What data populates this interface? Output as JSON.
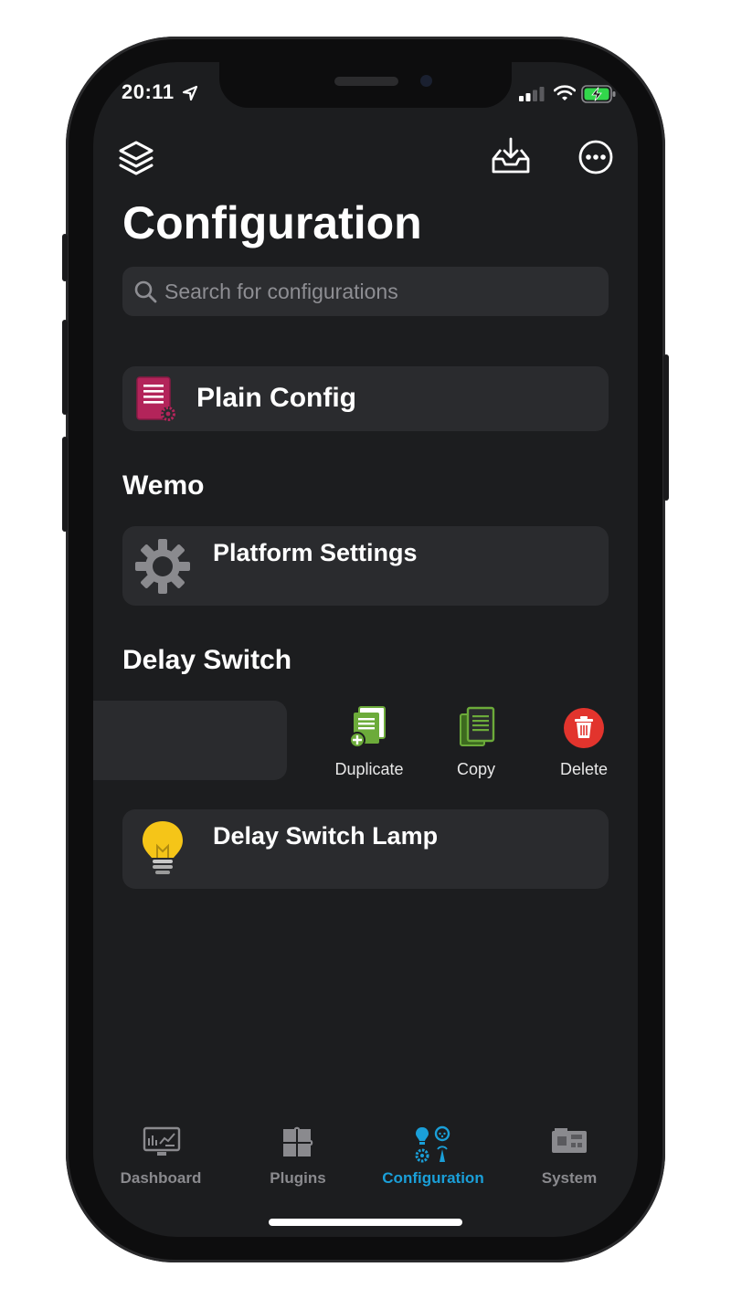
{
  "status_bar": {
    "time": "20:11",
    "icons": [
      "location-arrow-icon",
      "cellular-signal-icon",
      "wifi-icon",
      "battery-charging-icon"
    ]
  },
  "toolbar": {
    "left_icon": "layers-icon",
    "right_icons": [
      "inbox-download-icon",
      "more-ellipsis-icon"
    ]
  },
  "page": {
    "title": "Configuration"
  },
  "search": {
    "placeholder": "Search for configurations",
    "value": ""
  },
  "items": {
    "plain_config": {
      "label": "Plain Config",
      "icon": "config-document-icon"
    },
    "wemo": {
      "heading": "Wemo",
      "platform_settings": {
        "label": "Platform Settings",
        "icon": "gear-icon"
      }
    },
    "delay_switch": {
      "heading": "Delay Switch",
      "swipe_actions": [
        {
          "label": "Duplicate",
          "icon": "duplicate-icon"
        },
        {
          "label": "Copy",
          "icon": "copy-icon"
        },
        {
          "label": "Delete",
          "icon": "trash-icon"
        }
      ],
      "lamp": {
        "label": "Delay Switch Lamp",
        "icon": "lightbulb-icon"
      }
    }
  },
  "tab_bar": {
    "tabs": [
      {
        "label": "Dashboard",
        "icon": "dashboard-icon",
        "active": false
      },
      {
        "label": "Plugins",
        "icon": "puzzle-icon",
        "active": false
      },
      {
        "label": "Configuration",
        "icon": "configuration-icon",
        "active": true
      },
      {
        "label": "System",
        "icon": "chip-board-icon",
        "active": false
      }
    ]
  },
  "colors": {
    "background": "#1c1d1f",
    "card": "#2a2b2e",
    "accent_active": "#1a9fd8",
    "inactive": "#8a8a8e",
    "delete_red": "#e2342d",
    "duplicate_green": "#6cab3a",
    "plain_config_magenta": "#b3245a",
    "bulb_yellow": "#f5c518"
  }
}
